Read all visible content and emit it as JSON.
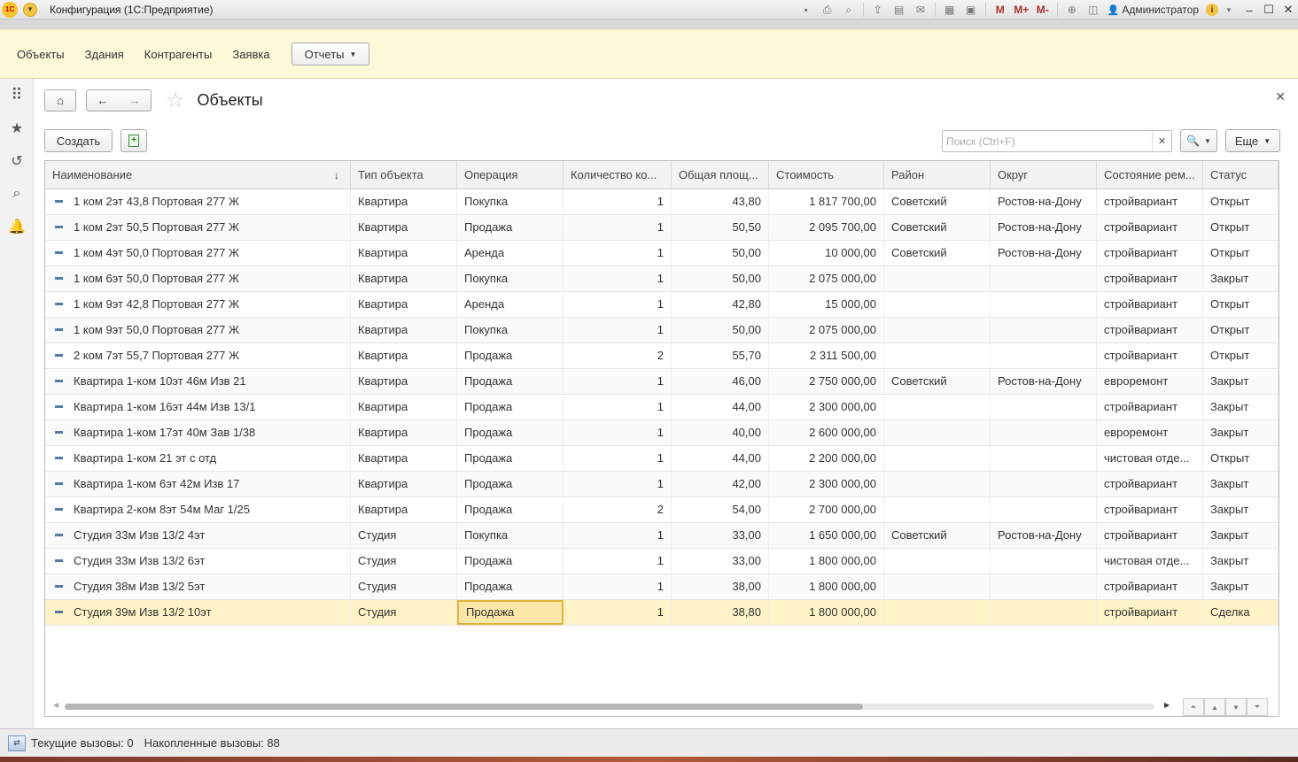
{
  "window": {
    "title": "Конфигурация  (1С:Предприятие)",
    "user": "Администратор",
    "m_labels": [
      "M",
      "M+",
      "M-"
    ]
  },
  "sections": {
    "items": [
      "Объекты",
      "Здания",
      "Контрагенты",
      "Заявка"
    ],
    "reports_label": "Отчеты"
  },
  "form": {
    "title": "Объекты",
    "create_label": "Создать",
    "search_placeholder": "Поиск (Ctrl+F)",
    "more_label": "Еще"
  },
  "table": {
    "columns": [
      "Наименование",
      "Тип объекта",
      "Операция",
      "Количество ко...",
      "Общая площ...",
      "Стоимость",
      "Район",
      "Округ",
      "Состояние рем...",
      "Статус"
    ],
    "rows": [
      [
        "1 ком 2эт 43,8 Портовая 277 Ж",
        "Квартира",
        "Покупка",
        "1",
        "43,80",
        "1 817 700,00",
        "Советский",
        "Ростов-на-Дону",
        "стройвариант",
        "Открыт"
      ],
      [
        "1 ком 2эт 50,5 Портовая 277 Ж",
        "Квартира",
        "Продажа",
        "1",
        "50,50",
        "2 095 700,00",
        "Советский",
        "Ростов-на-Дону",
        "стройвариант",
        "Открыт"
      ],
      [
        "1 ком 4эт 50,0 Портовая 277 Ж",
        "Квартира",
        "Аренда",
        "1",
        "50,00",
        "10 000,00",
        "Советский",
        "Ростов-на-Дону",
        "стройвариант",
        "Открыт"
      ],
      [
        "1 ком 6эт 50,0 Портовая 277 Ж",
        "Квартира",
        "Покупка",
        "1",
        "50,00",
        "2 075 000,00",
        "",
        "",
        "стройвариант",
        "Закрыт"
      ],
      [
        "1 ком 9эт 42,8 Портовая 277 Ж",
        "Квартира",
        "Аренда",
        "1",
        "42,80",
        "15 000,00",
        "",
        "",
        "стройвариант",
        "Открыт"
      ],
      [
        "1 ком 9эт 50,0 Портовая 277 Ж",
        "Квартира",
        "Покупка",
        "1",
        "50,00",
        "2 075 000,00",
        "",
        "",
        "стройвариант",
        "Открыт"
      ],
      [
        "2 ком 7эт 55,7 Портовая 277 Ж",
        "Квартира",
        "Продажа",
        "2",
        "55,70",
        "2 311 500,00",
        "",
        "",
        "стройвариант",
        "Открыт"
      ],
      [
        "Квартира 1-ком 10эт 46м Изв 21",
        "Квартира",
        "Продажа",
        "1",
        "46,00",
        "2 750 000,00",
        "Советский",
        "Ростов-на-Дону",
        "евроремонт",
        "Закрыт"
      ],
      [
        "Квартира 1-ком 16эт 44м Изв 13/1",
        "Квартира",
        "Продажа",
        "1",
        "44,00",
        "2 300 000,00",
        "",
        "",
        "стройвариант",
        "Закрыт"
      ],
      [
        "Квартира 1-ком 17эт 40м Зав 1/38",
        "Квартира",
        "Продажа",
        "1",
        "40,00",
        "2 600 000,00",
        "",
        "",
        "евроремонт",
        "Закрыт"
      ],
      [
        "Квартира 1-ком 21 эт с отд",
        "Квартира",
        "Продажа",
        "1",
        "44,00",
        "2 200 000,00",
        "",
        "",
        "чистовая отде...",
        "Открыт"
      ],
      [
        "Квартира 1-ком 6эт 42м Изв 17",
        "Квартира",
        "Продажа",
        "1",
        "42,00",
        "2 300 000,00",
        "",
        "",
        "стройвариант",
        "Закрыт"
      ],
      [
        "Квартира 2-ком 8эт 54м Маг 1/25",
        "Квартира",
        "Продажа",
        "2",
        "54,00",
        "2 700 000,00",
        "",
        "",
        "стройвариант",
        "Закрыт"
      ],
      [
        "Студия 33м Изв 13/2 4эт",
        "Студия",
        "Покупка",
        "1",
        "33,00",
        "1 650 000,00",
        "Советский",
        "Ростов-на-Дону",
        "стройвариант",
        "Закрыт"
      ],
      [
        "Студия 33м Изв 13/2 6эт",
        "Студия",
        "Продажа",
        "1",
        "33,00",
        "1 800 000,00",
        "",
        "",
        "чистовая отде...",
        "Закрыт"
      ],
      [
        "Студия 38м Изв 13/2 5эт",
        "Студия",
        "Продажа",
        "1",
        "38,00",
        "1 800 000,00",
        "",
        "",
        "стройвариант",
        "Закрыт"
      ],
      [
        "Студия 39м Изв 13/2 10эт",
        "Студия",
        "Продажа",
        "1",
        "38,80",
        "1 800 000,00",
        "",
        "",
        "стройвариант",
        "Сделка"
      ]
    ],
    "selected_row": 16,
    "selected_col": 2
  },
  "status": {
    "current_calls": "Текущие вызовы: 0",
    "accumulated_calls": "Накопленные вызовы: 88"
  }
}
